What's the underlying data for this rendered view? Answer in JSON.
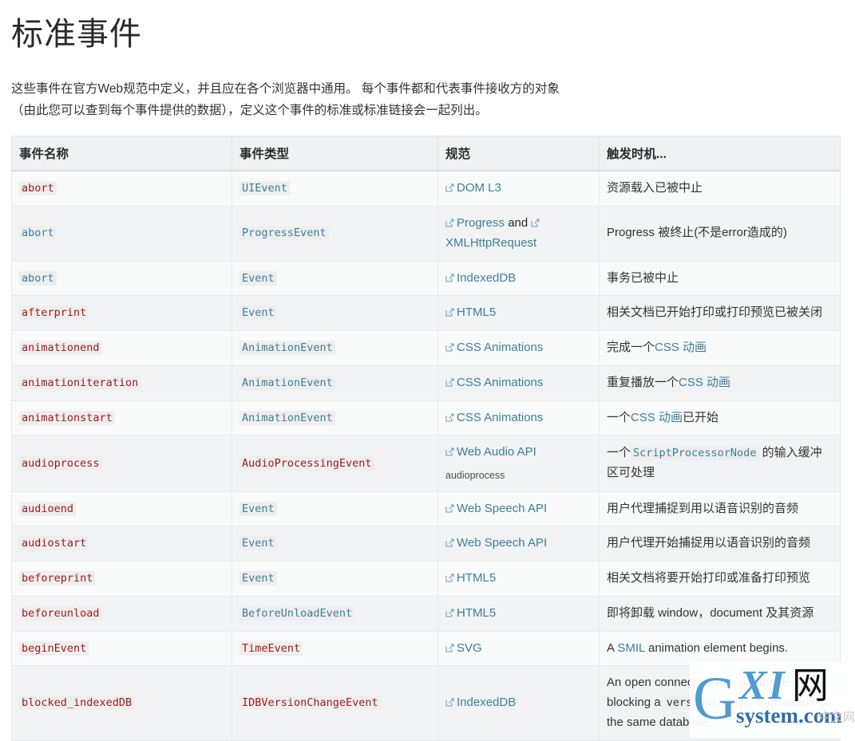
{
  "page": {
    "title": "标准事件",
    "intro": "这些事件在官方Web规范中定义，并且应在各个浏览器中通用。 每个事件都和代表事件接收方的对象（由此您可以查到每个事件提供的数据），定义这个事件的标准或标准链接会一起列出。"
  },
  "table": {
    "headers": [
      "事件名称",
      "事件类型",
      "规范",
      "触发时机..."
    ],
    "rows": [
      {
        "name": "abort",
        "name_link": false,
        "type": "UIEvent",
        "type_link": true,
        "spec": [
          {
            "text": "DOM L3",
            "link": true
          }
        ],
        "spec_sub": "",
        "desc": [
          {
            "text": "资源载入已被中止",
            "style": "plain"
          }
        ]
      },
      {
        "name": "abort",
        "name_link": true,
        "type": "ProgressEvent",
        "type_link": true,
        "spec": [
          {
            "text": "Progress",
            "link": true
          },
          {
            "text": " and ",
            "link": false
          },
          {
            "text": "XMLHttpRequest",
            "link": true
          }
        ],
        "spec_sub": "",
        "desc": [
          {
            "text": "Progress 被终止(不是error造成的)",
            "style": "plain"
          }
        ]
      },
      {
        "name": "abort",
        "name_link": true,
        "type": "Event",
        "type_link": true,
        "spec": [
          {
            "text": "IndexedDB",
            "link": true
          }
        ],
        "spec_sub": "",
        "desc": [
          {
            "text": "事务已被中止",
            "style": "plain"
          }
        ]
      },
      {
        "name": "afterprint",
        "name_link": false,
        "type": "Event",
        "type_link": true,
        "spec": [
          {
            "text": "HTML5",
            "link": true
          }
        ],
        "spec_sub": "",
        "desc": [
          {
            "text": "相关文档已开始打印或打印预览已被关闭",
            "style": "plain"
          }
        ]
      },
      {
        "name": "animationend",
        "name_link": false,
        "type": "AnimationEvent",
        "type_link": true,
        "spec": [
          {
            "text": "CSS Animations",
            "link": true
          }
        ],
        "spec_sub": "",
        "desc": [
          {
            "text": "完成一个",
            "style": "plain"
          },
          {
            "text": "CSS 动画",
            "style": "link"
          }
        ]
      },
      {
        "name": "animationiteration",
        "name_link": false,
        "type": "AnimationEvent",
        "type_link": true,
        "spec": [
          {
            "text": "CSS Animations",
            "link": true
          }
        ],
        "spec_sub": "",
        "desc": [
          {
            "text": "重复播放一个",
            "style": "plain"
          },
          {
            "text": "CSS 动画",
            "style": "link"
          }
        ]
      },
      {
        "name": "animationstart",
        "name_link": false,
        "type": "AnimationEvent",
        "type_link": true,
        "spec": [
          {
            "text": "CSS Animations",
            "link": true
          }
        ],
        "spec_sub": "",
        "desc": [
          {
            "text": "一个",
            "style": "plain"
          },
          {
            "text": "CSS 动画",
            "style": "link"
          },
          {
            "text": "已开始",
            "style": "plain"
          }
        ]
      },
      {
        "name": "audioprocess",
        "name_link": false,
        "type": "AudioProcessingEvent",
        "type_link": false,
        "spec": [
          {
            "text": "Web Audio API",
            "link": true
          }
        ],
        "spec_sub": "audioprocess",
        "desc": [
          {
            "text": "一个",
            "style": "plain"
          },
          {
            "text": "ScriptProcessorNode",
            "style": "code-link"
          },
          {
            "text": " 的输入缓冲区可处理",
            "style": "plain"
          }
        ]
      },
      {
        "name": "audioend",
        "name_link": false,
        "type": "Event",
        "type_link": true,
        "spec": [
          {
            "text": "Web Speech API",
            "link": true
          }
        ],
        "spec_sub": "",
        "desc": [
          {
            "text": "用户代理捕捉到用以语音识别的音频",
            "style": "plain"
          }
        ]
      },
      {
        "name": "audiostart",
        "name_link": false,
        "type": "Event",
        "type_link": true,
        "spec": [
          {
            "text": "Web Speech API",
            "link": true
          }
        ],
        "spec_sub": "",
        "desc": [
          {
            "text": "用户代理开始捕捉用以语音识别的音频",
            "style": "plain"
          }
        ]
      },
      {
        "name": "beforeprint",
        "name_link": false,
        "type": "Event",
        "type_link": true,
        "spec": [
          {
            "text": "HTML5",
            "link": true
          }
        ],
        "spec_sub": "",
        "desc": [
          {
            "text": "相关文档将要开始打印或准备打印预览",
            "style": "plain"
          }
        ]
      },
      {
        "name": "beforeunload",
        "name_link": false,
        "type": "BeforeUnloadEvent",
        "type_link": true,
        "spec": [
          {
            "text": "HTML5",
            "link": true
          }
        ],
        "spec_sub": "",
        "desc": [
          {
            "text": "即将卸载 window，document 及其资源",
            "style": "plain"
          }
        ]
      },
      {
        "name": "beginEvent",
        "name_link": false,
        "type": "TimeEvent",
        "type_link": false,
        "spec": [
          {
            "text": "SVG",
            "link": true
          }
        ],
        "spec_sub": "",
        "desc": [
          {
            "text": "A ",
            "style": "plain"
          },
          {
            "text": "SMIL",
            "style": "link"
          },
          {
            "text": " animation element begins.",
            "style": "plain"
          }
        ]
      },
      {
        "name": "blocked_indexedDB",
        "name_link": false,
        "type": "IDBVersionChangeEvent",
        "type_link": false,
        "spec": [
          {
            "text": "IndexedDB",
            "link": true
          }
        ],
        "spec_sub": "",
        "desc": [
          {
            "text": "An open connection to a database is blocking",
            "style": "plain"
          },
          {
            "text": "\na ",
            "style": "plain"
          },
          {
            "text": "versionchange",
            "style": "code-plain"
          },
          {
            "text": " transaction on the same database.",
            "style": "plain"
          }
        ]
      }
    ]
  },
  "watermark": {
    "g": "G",
    "xi": "XI",
    "cn": "网",
    "sys": "system.com",
    "faint": "中文网"
  },
  "colors": {
    "link": "#3d7e9a",
    "code_red": "#a11a1a",
    "header_bg": "#eff1f2",
    "row_bg_odd": "#f9fafa",
    "row_bg_even": "#f2f3f4",
    "border": "#e6e9eb"
  }
}
